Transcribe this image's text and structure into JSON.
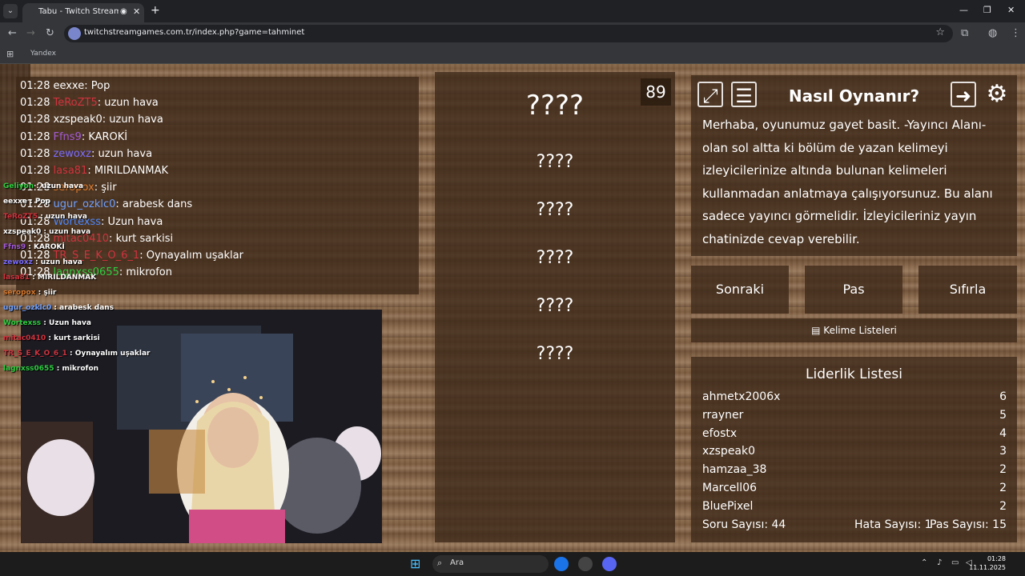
{
  "browser": {
    "tab_title": "Tabu - Twitch Stream Game",
    "url": "twitchstreamgames.com.tr/index.php?game=tahminet",
    "bookmark": "Yandex"
  },
  "chat": [
    {
      "time": "01:28",
      "user": "eexxe",
      "msg": "Pop",
      "color": "#ffffff"
    },
    {
      "time": "01:28",
      "user": "TeRoZT5",
      "msg": "uzun hava",
      "color": "#d0333e"
    },
    {
      "time": "01:28",
      "user": "xzspeak0",
      "msg": "uzun hava",
      "color": "#ffffff"
    },
    {
      "time": "01:28",
      "user": "Ffns9",
      "msg": "KAROKİ",
      "color": "#a35bd6"
    },
    {
      "time": "01:28",
      "user": "zewoxz",
      "msg": "uzun hava",
      "color": "#7a6cff"
    },
    {
      "time": "01:28",
      "user": "lasa81",
      "msg": "MIRILDANMAK",
      "color": "#d0333e"
    },
    {
      "time": "01:28",
      "user": "seropox",
      "msg": "şiir",
      "color": "#d8792e"
    },
    {
      "time": "01:28",
      "user": "ugur_ozklc0",
      "msg": "arabesk dans",
      "color": "#6ea0ff"
    },
    {
      "time": "01:28",
      "user": "Wortexss",
      "msg": "Uzun hava",
      "color": "#4b88ff"
    },
    {
      "time": "01:28",
      "user": "mitac0410",
      "msg": "kurt sarkisi",
      "color": "#d0333e"
    },
    {
      "time": "01:28",
      "user": "TR_S_E_K_O_6_1",
      "msg": "Oynayalım uşaklar",
      "color": "#d0333e"
    },
    {
      "time": "01:28",
      "user": "lagnxss0655",
      "msg": "mikrofon",
      "color": "#2ecc40"
    }
  ],
  "overlay_chat": [
    {
      "user": "Geliyon",
      "msg": "uzun hava",
      "color": "#2ecc40"
    },
    {
      "user": "eexxe",
      "msg": "Pop",
      "color": "#ffffff"
    },
    {
      "user": "TeRoZT5",
      "msg": "uzun hava",
      "color": "#d0333e"
    },
    {
      "user": "xzspeak0",
      "msg": "uzun hava",
      "color": "#ffffff"
    },
    {
      "user": "Ffns9",
      "msg": "KAROKİ",
      "color": "#a35bd6"
    },
    {
      "user": "zewoxz",
      "msg": "uzun hava",
      "color": "#7a6cff"
    },
    {
      "user": "lasa81",
      "msg": "MIRILDANMAK",
      "color": "#d0333e"
    },
    {
      "user": "seropox",
      "msg": "şiir",
      "color": "#d8792e"
    },
    {
      "user": "ugur_ozklc0",
      "msg": "arabesk dans",
      "color": "#6ea0ff"
    },
    {
      "user": "Wortexss",
      "msg": "Uzun hava",
      "color": "#2ecc40"
    },
    {
      "user": "mitac0410",
      "msg": "kurt sarkisi",
      "color": "#d0333e"
    },
    {
      "user": "TR_S_E_K_O_6_1",
      "msg": "Oynayalım uşaklar",
      "color": "#d0333e"
    },
    {
      "user": "lagnxss0655",
      "msg": "mikrofon",
      "color": "#2ecc40"
    }
  ],
  "game": {
    "counter": "89",
    "main_word": "????",
    "forbidden": [
      "????",
      "????",
      "????",
      "????",
      "????"
    ]
  },
  "howto": {
    "title": "Nasıl Oynanır?",
    "text": "Merhaba, oyunumuz gayet basit. -Yayıncı Alanı- olan sol altta ki bölüm de yazan kelimeyi izleyicilerinize altında bulunan kelimeleri kullanmadan anlatmaya çalışıyorsunuz. Bu alanı sadece yayıncı görmelidir. İzleyicileriniz yayın chatinizde cevap verebilir."
  },
  "buttons": {
    "next": "Sonraki",
    "pass": "Pas",
    "reset": "Sıfırla",
    "word_lists": "Kelime Listeleri"
  },
  "leaderboard": {
    "title": "Liderlik Listesi",
    "rows": [
      {
        "name": "ahmetx2006x",
        "score": "6"
      },
      {
        "name": "rrayner",
        "score": "5"
      },
      {
        "name": "efostx",
        "score": "4"
      },
      {
        "name": "xzspeak0",
        "score": "3"
      },
      {
        "name": "hamzaa_38",
        "score": "2"
      },
      {
        "name": "Marcell06",
        "score": "2"
      },
      {
        "name": "BluePixel",
        "score": "2"
      }
    ],
    "question_count": "Soru Sayısı: 44",
    "error_count": "Hata Sayısı: 1",
    "pass_count": "Pas Sayısı: 15"
  },
  "taskbar": {
    "search": "Ara",
    "time": "01:28",
    "date": "11.11.2025"
  }
}
